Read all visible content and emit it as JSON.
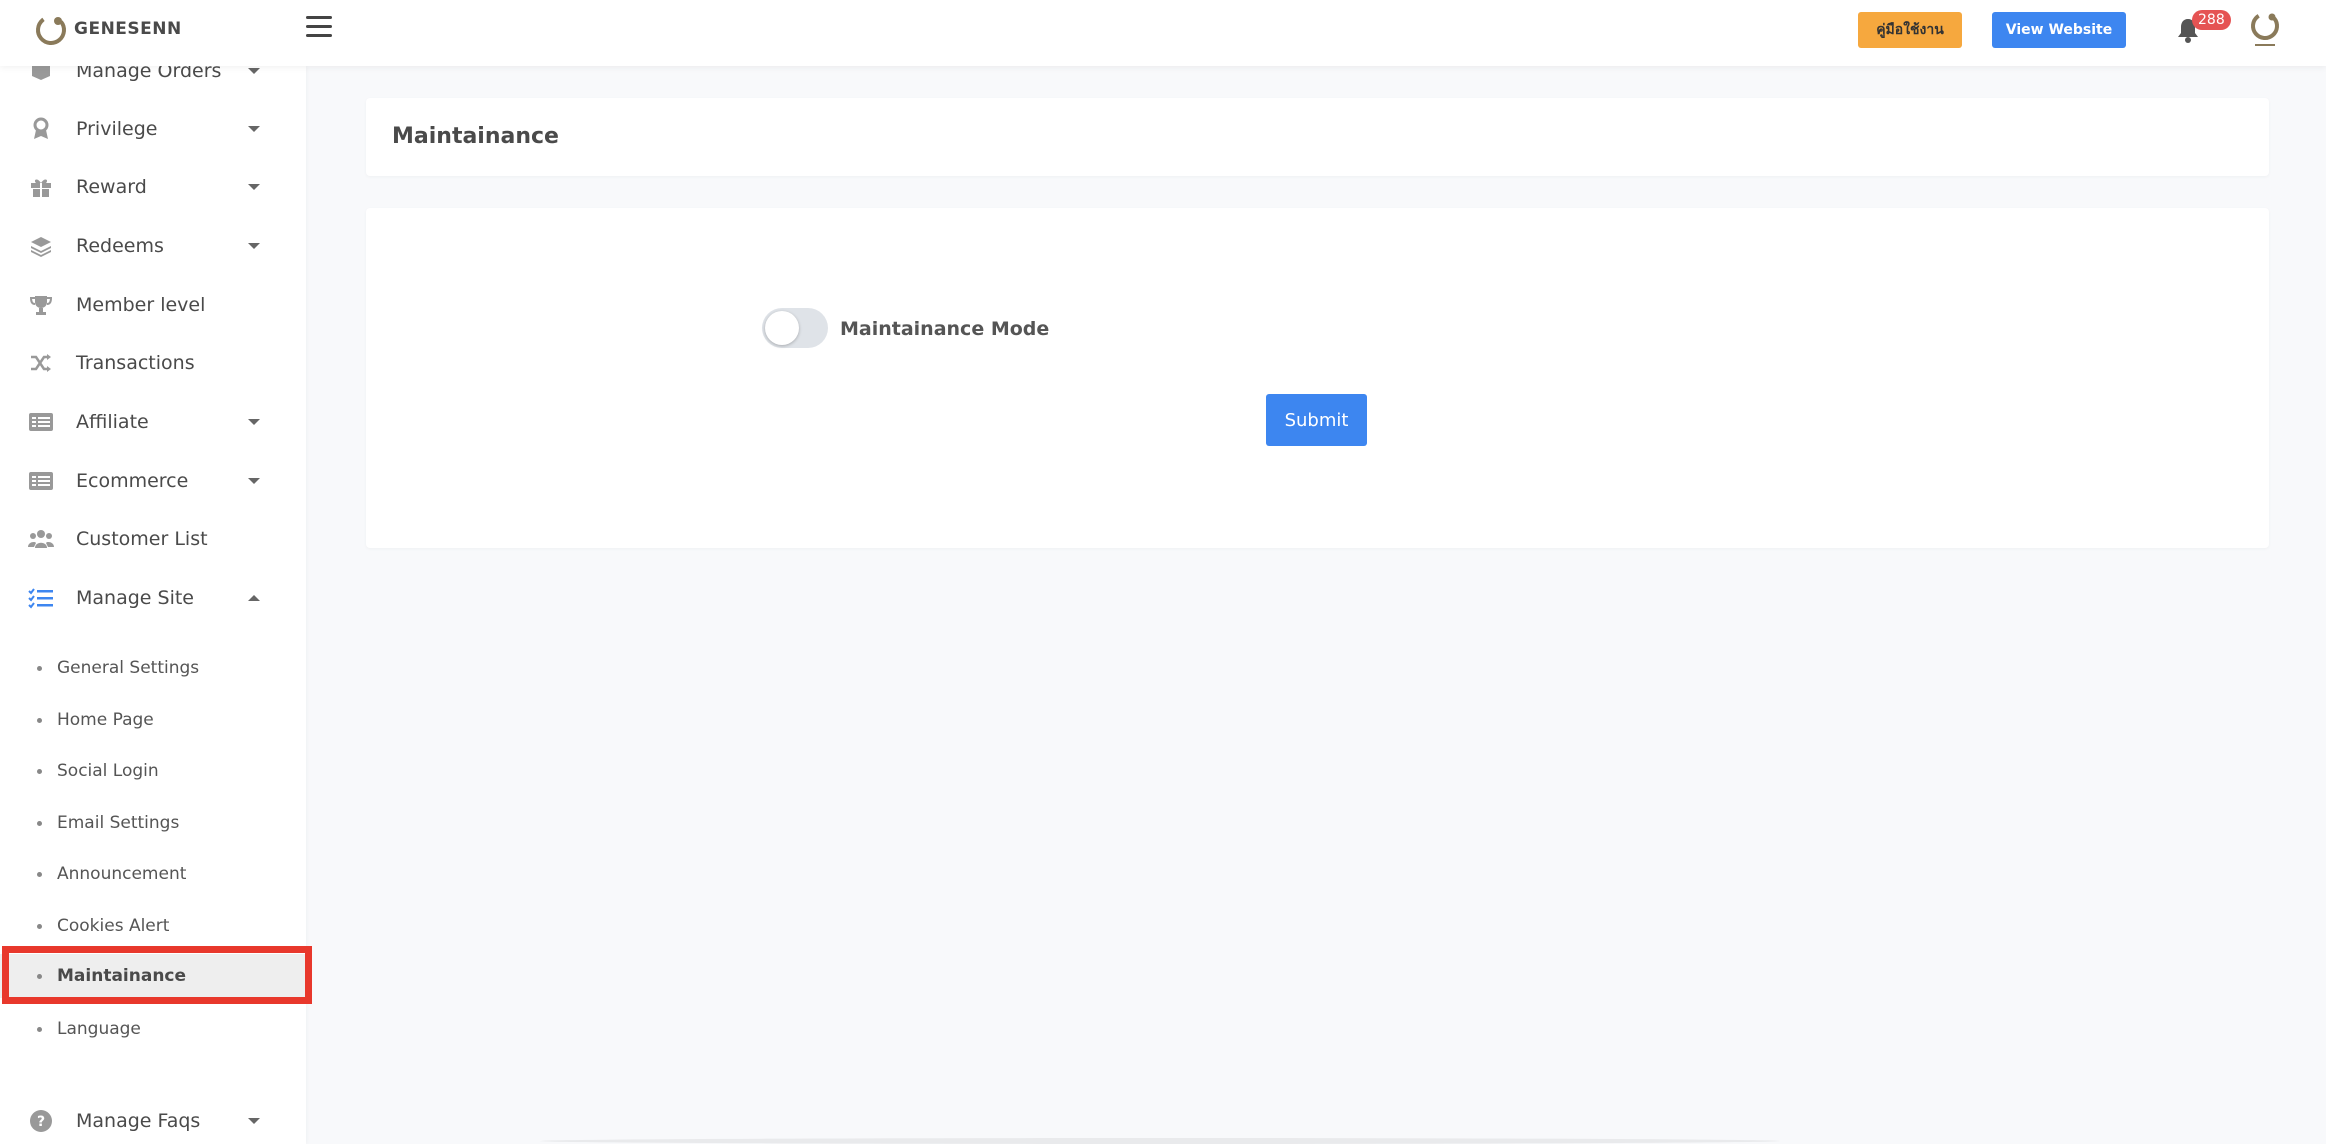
{
  "brand": {
    "name": "GENESENN",
    "accent": "#3d86f0",
    "warning": "#f6a83e",
    "badge_color": "#e55353"
  },
  "topbar": {
    "manual_label": "คู่มือใช้งาน",
    "view_website_label": "View Website",
    "notification_count": "288"
  },
  "sidebar": {
    "items": [
      {
        "label": "Manage Orders",
        "icon": "box-icon",
        "caret": true
      },
      {
        "label": "Privilege",
        "icon": "award-icon",
        "caret": true
      },
      {
        "label": "Reward",
        "icon": "gift-icon",
        "caret": true
      },
      {
        "label": "Redeems",
        "icon": "layers-icon",
        "caret": true
      },
      {
        "label": "Member level",
        "icon": "trophy-icon",
        "caret": false
      },
      {
        "label": "Transactions",
        "icon": "shuffle-icon",
        "caret": false
      },
      {
        "label": "Affiliate",
        "icon": "list-box-icon",
        "caret": true
      },
      {
        "label": "Ecommerce",
        "icon": "list-box-icon",
        "caret": true
      },
      {
        "label": "Customer List",
        "icon": "users-icon",
        "caret": false
      },
      {
        "label": "Manage Site",
        "icon": "checklist-icon",
        "caret": true,
        "expanded": true
      }
    ],
    "sub_items": [
      {
        "label": "General Settings"
      },
      {
        "label": "Home Page"
      },
      {
        "label": "Social Login"
      },
      {
        "label": "Email Settings"
      },
      {
        "label": "Announcement"
      },
      {
        "label": "Cookies Alert"
      },
      {
        "label": "Maintainance",
        "active": true
      },
      {
        "label": "Language"
      }
    ],
    "footer_item": {
      "label": "Manage Faqs",
      "icon": "question-circle-icon"
    }
  },
  "main": {
    "title": "Maintainance",
    "toggle_label": "Maintainance Mode",
    "toggle_on": false,
    "submit_label": "Submit"
  }
}
